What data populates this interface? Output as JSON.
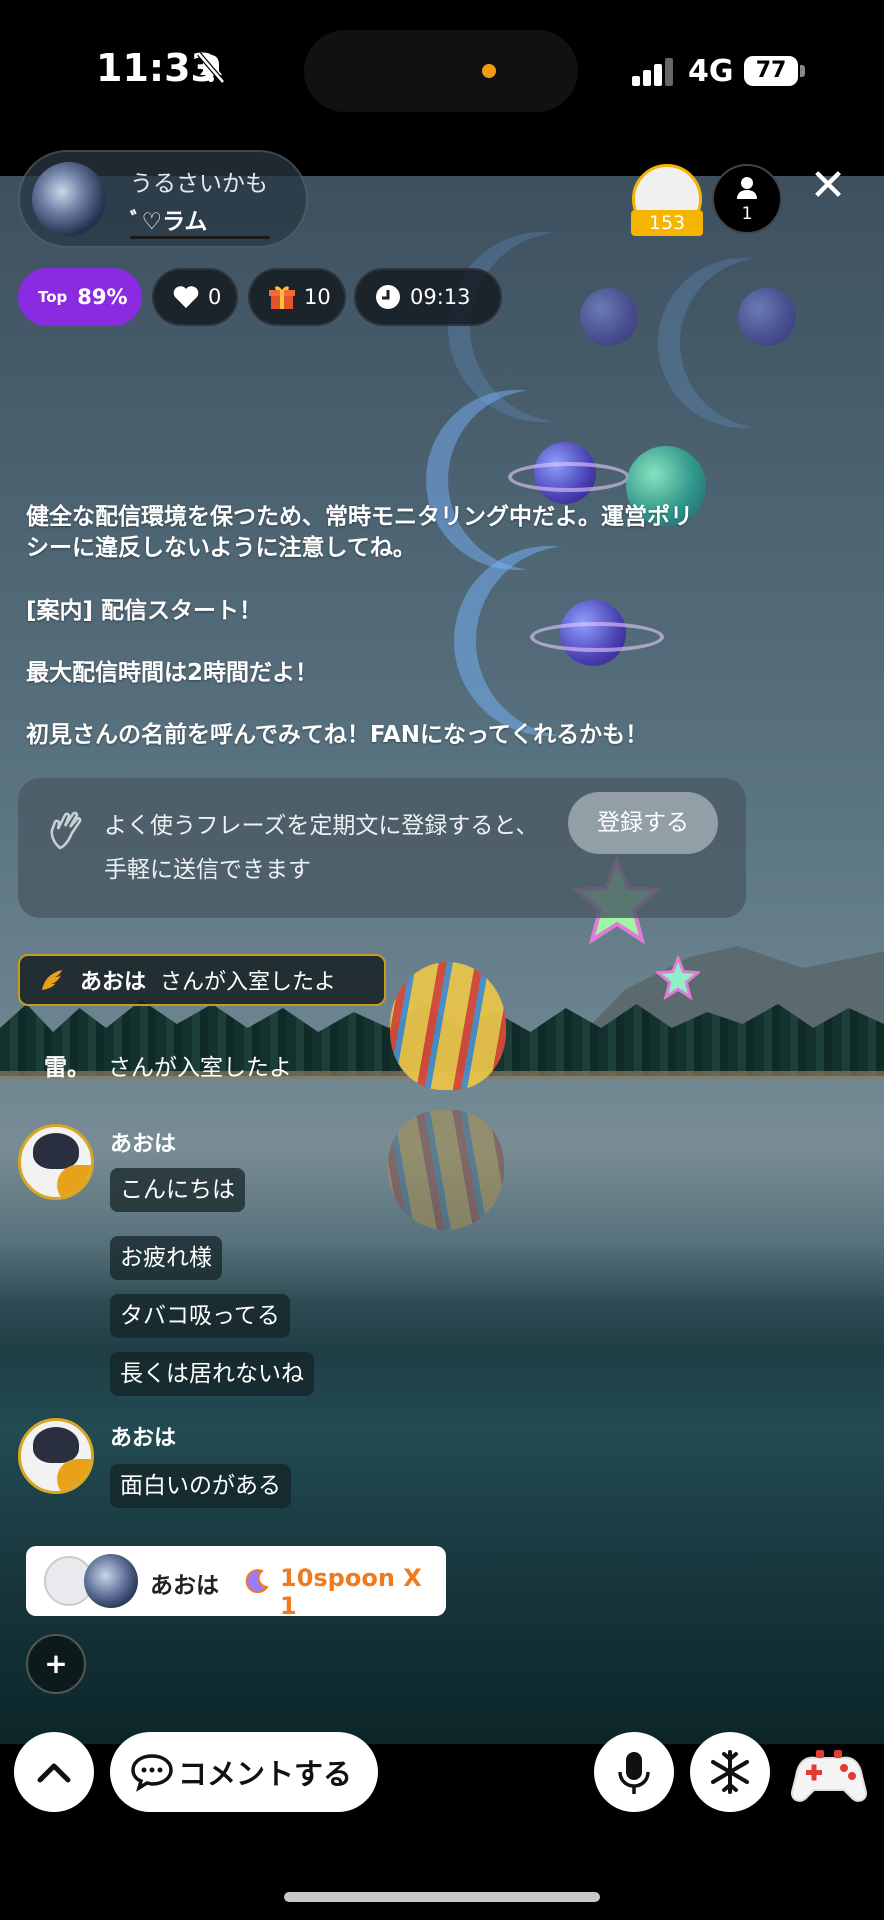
{
  "status_bar": {
    "time": "11:33",
    "network": "4G",
    "battery": "77"
  },
  "header": {
    "host_name": "うるさいかも",
    "host_subtitle": "ﾞ♡ラム",
    "top_fan_count": "153",
    "listener_count": "1",
    "close_glyph": "✕"
  },
  "stats": {
    "rank_label": "Top",
    "rank_value": "89%",
    "likes": "0",
    "gifts": "10",
    "elapsed": "09:13"
  },
  "system_messages": [
    "健全な配信環境を保つため、常時モニタリング中だよ。運営ポリシーに違反しないように注意してね。",
    "[案内] 配信スタート！",
    "最大配信時間は2時間だよ！",
    "初見さんの名前を呼んでみてね！FANになってくれるかも！"
  ],
  "phrase_tip": {
    "text": "よく使うフレーズを定期文に登録すると、手軽に送信できます",
    "button": "登録する"
  },
  "entries": [
    {
      "name": "あおは",
      "text": "さんが入室したよ"
    },
    {
      "name": "雷。",
      "text": "さんが入室したよ"
    }
  ],
  "chat": [
    {
      "author": "あおは",
      "messages": [
        "こんにちは",
        "お疲れ様",
        "タバコ吸ってる",
        "長くは居れないね"
      ]
    },
    {
      "author": "あおは",
      "messages": [
        "面白いのがある"
      ]
    }
  ],
  "gift": {
    "name": "あおは",
    "value": "10spoon X 1"
  },
  "bottom_bar": {
    "plus_label": "+",
    "comment_label": "コメントする"
  },
  "colors": {
    "rank_purple": "#8a2be2",
    "gold": "#d7a625",
    "gift_orange": "#f27a1a"
  }
}
